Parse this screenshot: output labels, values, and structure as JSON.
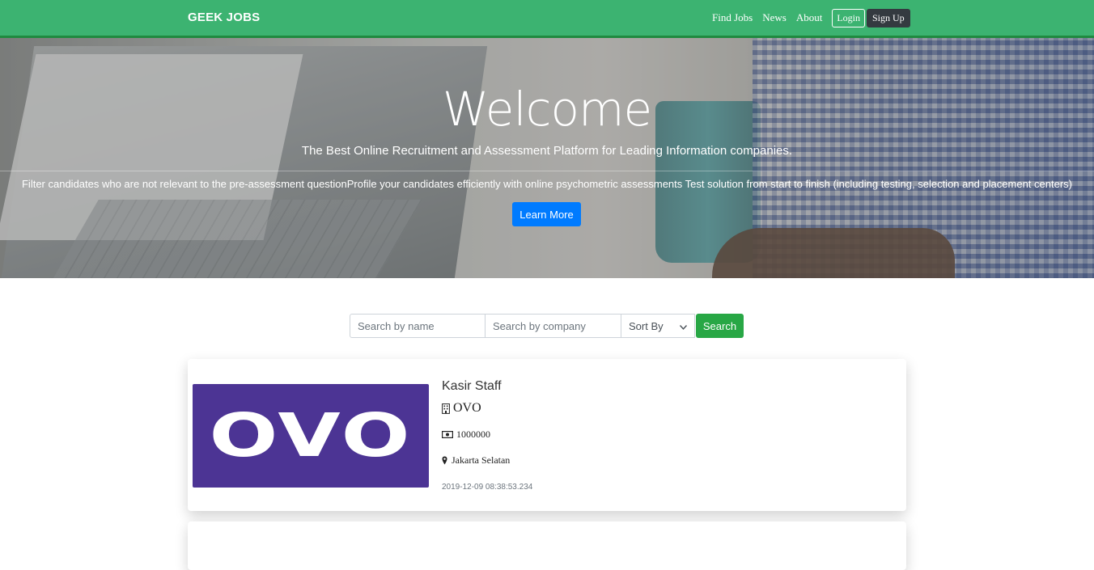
{
  "navbar": {
    "brand": "GEEK JOBS",
    "links": [
      "Find Jobs",
      "News",
      "About"
    ],
    "login_label": "Login",
    "signup_label": "Sign Up"
  },
  "hero": {
    "title": "Welcome",
    "subtitle": "The Best Online Recruitment and Assessment Platform for Leading Information companies.",
    "description": "Filter candidates who are not relevant to the pre-assessment questionProfile your candidates efficiently with online psychometric assessments Test solution from start to finish (including testing, selection and placement centers)",
    "learn_more_label": "Learn More"
  },
  "search": {
    "name_placeholder": "Search by name",
    "company_placeholder": "Search by company",
    "sort_label": "Sort By",
    "search_label": "Search"
  },
  "jobs": [
    {
      "logo_text": "OVO",
      "title": "Kasir Staff",
      "company": "OVO",
      "salary": "1000000",
      "location": "Jakarta Selatan",
      "date": "2019-12-09 08:38:53.234",
      "icons": [
        "building-icon",
        "money-icon",
        "map-marker-icon"
      ]
    }
  ],
  "colors": {
    "navbar": "#3cb371",
    "learn_more": "#007bff",
    "search_button": "#28a745",
    "signup_button": "#343a40",
    "logo_background": "#4c3494"
  }
}
